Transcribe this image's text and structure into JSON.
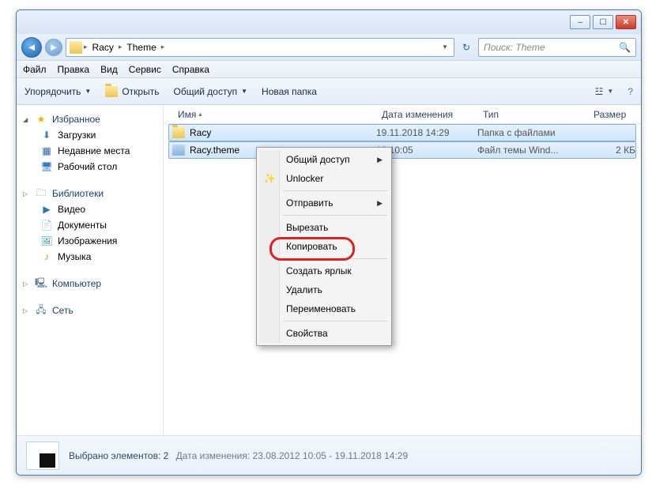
{
  "titlebar": {
    "min": "–",
    "max": "☐",
    "close": "✕"
  },
  "nav": {
    "back": "◄",
    "fwd": "►",
    "refresh": "↻",
    "dropdown": "▼"
  },
  "breadcrumbs": [
    "Racy",
    "Theme"
  ],
  "search": {
    "placeholder": "Поиск: Theme",
    "icon": "🔍"
  },
  "menubar": [
    "Файл",
    "Правка",
    "Вид",
    "Сервис",
    "Справка"
  ],
  "toolbar": {
    "organize": "Упорядочить",
    "open": "Открыть",
    "share": "Общий доступ",
    "newfolder": "Новая папка",
    "view": "☳",
    "help": "?"
  },
  "sidebar": {
    "favorites": {
      "label": "Избранное",
      "items": [
        {
          "label": "Загрузки",
          "icon": "⬇"
        },
        {
          "label": "Недавние места",
          "icon": "▦"
        },
        {
          "label": "Рабочий стол",
          "icon": "🖥"
        }
      ]
    },
    "libraries": {
      "label": "Библиотеки",
      "items": [
        {
          "label": "Видео",
          "icon": "▶"
        },
        {
          "label": "Документы",
          "icon": "📄"
        },
        {
          "label": "Изображения",
          "icon": "🖼"
        },
        {
          "label": "Музыка",
          "icon": "♪"
        }
      ]
    },
    "computer": {
      "label": "Компьютер",
      "icon": "🖳"
    },
    "network": {
      "label": "Сеть",
      "icon": "🖧"
    }
  },
  "columns": {
    "name": "Имя",
    "date": "Дата изменения",
    "type": "Тип",
    "size": "Размер"
  },
  "rows": [
    {
      "name": "Racy",
      "date": "19.11.2018 14:29",
      "type": "Папка с файлами",
      "size": "",
      "kind": "folder"
    },
    {
      "name": "Racy.theme",
      "date": "12 10:05",
      "type": "Файл темы Wind...",
      "size": "2 КБ",
      "kind": "theme"
    }
  ],
  "context": {
    "items": [
      {
        "label": "Общий доступ",
        "sub": true
      },
      {
        "label": "Unlocker",
        "icon": "wand"
      },
      {
        "sep": true
      },
      {
        "label": "Отправить",
        "sub": true
      },
      {
        "sep": true
      },
      {
        "label": "Вырезать"
      },
      {
        "label": "Копировать"
      },
      {
        "sep": true
      },
      {
        "label": "Создать ярлык"
      },
      {
        "label": "Удалить"
      },
      {
        "label": "Переименовать"
      },
      {
        "sep": true
      },
      {
        "label": "Свойства"
      }
    ]
  },
  "status": {
    "main": "Выбрано элементов: 2",
    "sub_label": "Дата изменения:",
    "sub_value": "23.08.2012 10:05 - 19.11.2018 14:29"
  }
}
